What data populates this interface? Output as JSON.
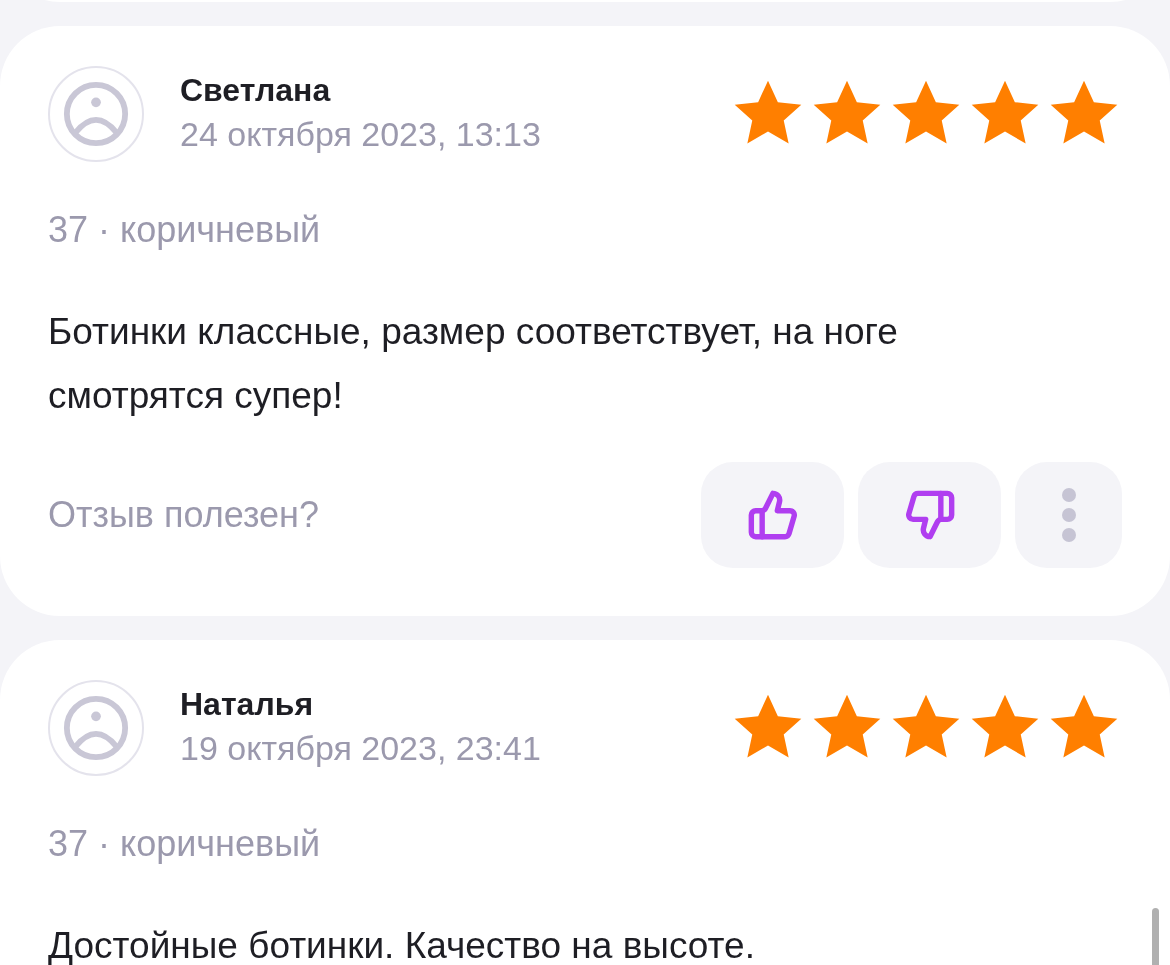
{
  "reviews": [
    {
      "author": "Светлана",
      "date": "24 октября 2023, 13:13",
      "stars": 5,
      "variant": "37 · коричневый",
      "text": "Ботинки классные, размер соответствует, на ноге смотрятся супер!",
      "helpful_prompt": "Отзыв полезен?"
    },
    {
      "author": "Наталья",
      "date": "19 октября 2023, 23:41",
      "stars": 5,
      "variant": "37 · коричневый",
      "text": "Достойные ботинки. Качество на высоте."
    }
  ]
}
